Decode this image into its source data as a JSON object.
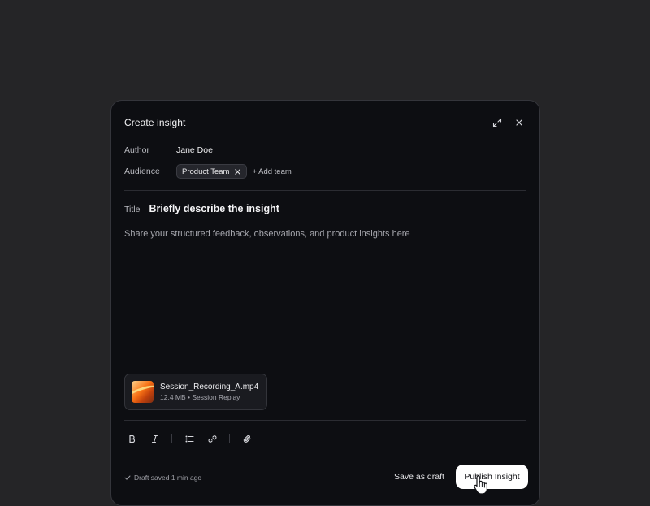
{
  "modal": {
    "title": "Create insight",
    "author_label": "Author",
    "author_value": "Jane Doe",
    "audience_label": "Audience",
    "audience_chip": "Product Team",
    "add_team": "+ Add team",
    "title_label": "Title",
    "title_placeholder": "Briefly describe the insight",
    "body_placeholder": "Share your structured feedback, observations, and product insights here"
  },
  "attachment": {
    "name": "Session_Recording_A.mp4",
    "size": "12.4 MB",
    "type": "Session Replay"
  },
  "footer": {
    "status": "Draft saved 1 min ago",
    "save_draft": "Save as draft",
    "publish": "Publish Insight"
  },
  "icons": {
    "expand": "expand-icon",
    "close": "close-icon",
    "bold": "bold-icon",
    "italic": "italic-icon",
    "list": "bulleted-list-icon",
    "link": "link-icon",
    "attach": "paperclip-icon",
    "check": "check-icon",
    "cursor": "hand-pointer-icon"
  },
  "colors": {
    "background": "#252527",
    "modal": "#0d0e12",
    "primary_button": "#ffffff"
  }
}
